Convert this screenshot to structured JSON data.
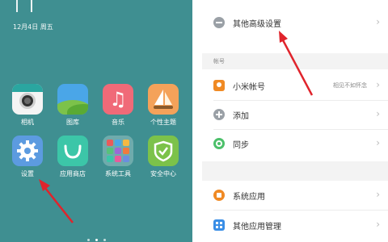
{
  "home": {
    "date": "12月4日 周五",
    "apps": [
      {
        "label": "相机",
        "icon": "camera-icon"
      },
      {
        "label": "图库",
        "icon": "gallery-icon"
      },
      {
        "label": "音乐",
        "icon": "music-icon"
      },
      {
        "label": "个性主题",
        "icon": "theme-icon"
      },
      {
        "label": "设置",
        "icon": "gear-icon"
      },
      {
        "label": "应用商店",
        "icon": "app-store-icon"
      },
      {
        "label": "系统工具",
        "icon": "tools-folder-icon"
      },
      {
        "label": "安全中心",
        "icon": "shield-icon"
      }
    ]
  },
  "settings": {
    "advanced_label": "其他高级设置",
    "account_section": "帐号",
    "mi_account_label": "小米帐号",
    "mi_account_value": "相见不如怀念",
    "add_label": "添加",
    "sync_label": "同步",
    "system_apps_label": "系统应用",
    "other_apps_label": "其他应用管理"
  },
  "colors": {
    "home_bg": "#3f8f91",
    "arrow": "#e0242c",
    "settings_bg": "#ffffff"
  }
}
